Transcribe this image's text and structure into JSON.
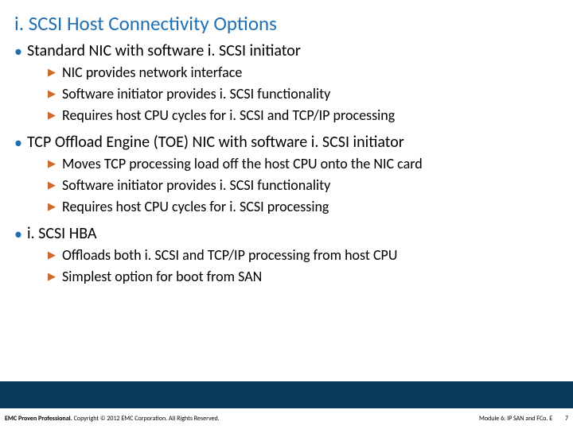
{
  "title": "i. SCSI Host Connectivity Options",
  "bullets": [
    {
      "text": "Standard NIC with software i. SCSI initiator",
      "subs": [
        "NIC provides network interface",
        "Software initiator provides i. SCSI functionality",
        "Requires host CPU cycles for i. SCSI and TCP/IP processing"
      ]
    },
    {
      "text": "TCP Offload Engine (TOE) NIC with software i. SCSI initiator",
      "subs": [
        "Moves TCP processing load off the host CPU onto the NIC card",
        "Software initiator provides i. SCSI functionality",
        "Requires host CPU cycles for i. SCSI processing"
      ]
    },
    {
      "text": "i. SCSI HBA",
      "subs": [
        "Offloads both i. SCSI and TCP/IP processing from host CPU",
        "Simplest option for boot from SAN"
      ]
    }
  ],
  "footer": {
    "strong": "EMC Proven Professional.",
    "rest": " Copyright © 2012 EMC Corporation. All Rights Reserved.",
    "module": "Module 6: IP SAN and FCo. E",
    "page": "7"
  }
}
